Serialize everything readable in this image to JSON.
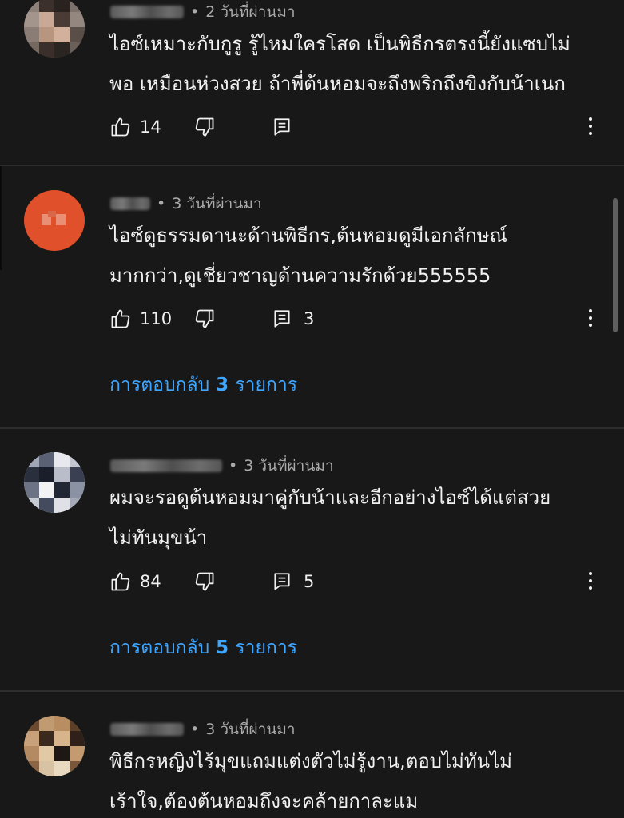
{
  "comments": [
    {
      "time": "2 วันที่ผ่านมา",
      "text_lines": [
        "ไอซ์เหมาะกับกูรู รู้ไหมใครโสด  เป็นพิธีกรตรงนี้ยังแซบไม่",
        "พอ เหมือนห่วงสวย  ถ้าพี่ต้นหอมจะถึงพริกถึงขิงกับน้าเนก"
      ],
      "likes": "14",
      "reply_count": ""
    },
    {
      "time": "3 วันที่ผ่านมา",
      "text_lines": [
        "ไอซ์ดูธรรมดานะด้านพิธีกร,ต้นหอมดูมีเอกลักษณ์",
        "มากกว่า,ดูเชี่ยวชาญด้านความรักด้วย555555"
      ],
      "likes": "110",
      "reply_count": "3",
      "replies_link": {
        "prefix": "การตอบกลับ",
        "count": "3",
        "suffix": "รายการ"
      }
    },
    {
      "time": "3 วันที่ผ่านมา",
      "text_lines": [
        "ผมจะรอดูต้นหอมมาคู่กับน้าและอีกอย่างไอซ์ได้แต่สวย",
        "ไม่ทันมุขน้า"
      ],
      "likes": "84",
      "reply_count": "5",
      "replies_link": {
        "prefix": "การตอบกลับ",
        "count": "5",
        "suffix": "รายการ"
      }
    },
    {
      "time": "3 วันที่ผ่านมา",
      "text_lines": [
        "พิธีกรหญิงไร้มุขแถมแต่งตัวไม่รู้งาน,ตอบไม่ทันไม่",
        "เร้าใจ,ต้องต้นหอมถึงจะคล้ายกาละแม"
      ],
      "likes": "",
      "reply_count": ""
    }
  ],
  "dot_separator": "•",
  "colors": {
    "background": "#181818",
    "text": "#f1f1f1",
    "secondary_text": "#aaaaaa",
    "link": "#3ea6ff",
    "divider": "#2e2e2e"
  },
  "icons": [
    "like-icon",
    "dislike-icon",
    "reply-icon",
    "more-vert-icon"
  ]
}
